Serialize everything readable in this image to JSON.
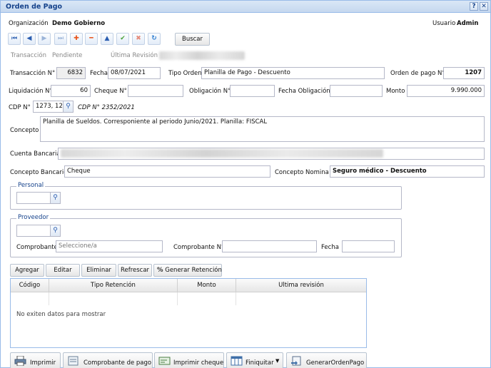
{
  "window": {
    "title": "Orden de Pago",
    "help_label": "?",
    "close_label": "✕"
  },
  "header": {
    "org_label": "Organización",
    "org_value": "Demo Gobierno",
    "user_label": "Usuario",
    "user_value": "Admin"
  },
  "toolbar": {
    "search_label": "Buscar"
  },
  "status": {
    "transaccion_label": "Transacción",
    "estado": "Pendiente",
    "ultima_revision_label": "Última Revisión"
  },
  "form": {
    "transaccion_label": "Transacción N°",
    "transaccion_value": "6832",
    "fecha_label": "Fecha",
    "fecha_value": "08/07/2021",
    "tipo_orden_label": "Tipo Orden",
    "tipo_orden_value": "Planilla de Pago - Descuento",
    "orden_pago_label": "Orden de pago N°",
    "orden_pago_value": "1207",
    "liquidacion_label": "Liquidación N°",
    "liquidacion_value": "60",
    "cheque_label": "Cheque N°",
    "cheque_value": "",
    "obligacion_label": "Obligación N°",
    "obligacion_value": "",
    "fecha_obligacion_label": "Fecha Obligación",
    "fecha_obligacion_value": "",
    "monto_label": "Monto",
    "monto_value": "9.990.000",
    "cdp_label": "CDP N°",
    "cdp_value": "1273, 12",
    "cdp_note": "CDP N° 2352/2021",
    "concepto_label": "Concepto",
    "concepto_value": "Planilla de Sueldos.  Corresponiente al periodo Junio/2021. Planilla: FISCAL",
    "cuenta_label": "Cuenta Bancaria",
    "concepto_bancario_label": "Concepto Bancario",
    "concepto_bancario_value": "Cheque",
    "concepto_nomina_label": "Concepto Nomina",
    "concepto_nomina_value": "Seguro médico - Descuento"
  },
  "personal": {
    "legend": "Personal"
  },
  "proveedor": {
    "legend": "Proveedor",
    "comprobante_label": "Comprobante",
    "comprobante_placeholder": "Seleccione/a",
    "comprobante_n_label": "Comprobante N°",
    "fecha_label": "Fecha"
  },
  "grid_toolbar": {
    "agregar": "Agregar",
    "editar": "Editar",
    "eliminar": "Eliminar",
    "refrescar": "Refrescar",
    "generar": "Generar Retención"
  },
  "grid": {
    "columns": [
      "Código",
      "Tipo Retención",
      "Monto",
      "Ultima revisión"
    ],
    "empty_text": "No exiten datos para mostrar"
  },
  "bottom": {
    "imprimir": "Imprimir",
    "comprobante_pago": "Comprobante de pago",
    "imprimir_cheque": "Imprimir cheque",
    "finiquitar": "Finiquitar",
    "generar_orden": "GenerarOrdenPago"
  },
  "icons": {
    "first": "first-icon",
    "prev": "prev-icon",
    "next": "next-icon",
    "last": "last-icon",
    "add": "plus-icon",
    "remove": "minus-icon",
    "up": "up-icon",
    "accept": "check-icon",
    "cancel": "x-icon",
    "refresh": "refresh-icon",
    "search": "magnifier-icon"
  },
  "colors": {
    "title": "#15428b",
    "border": "#99bbe8",
    "add": "#e8541c",
    "accept": "#4aa23a"
  }
}
